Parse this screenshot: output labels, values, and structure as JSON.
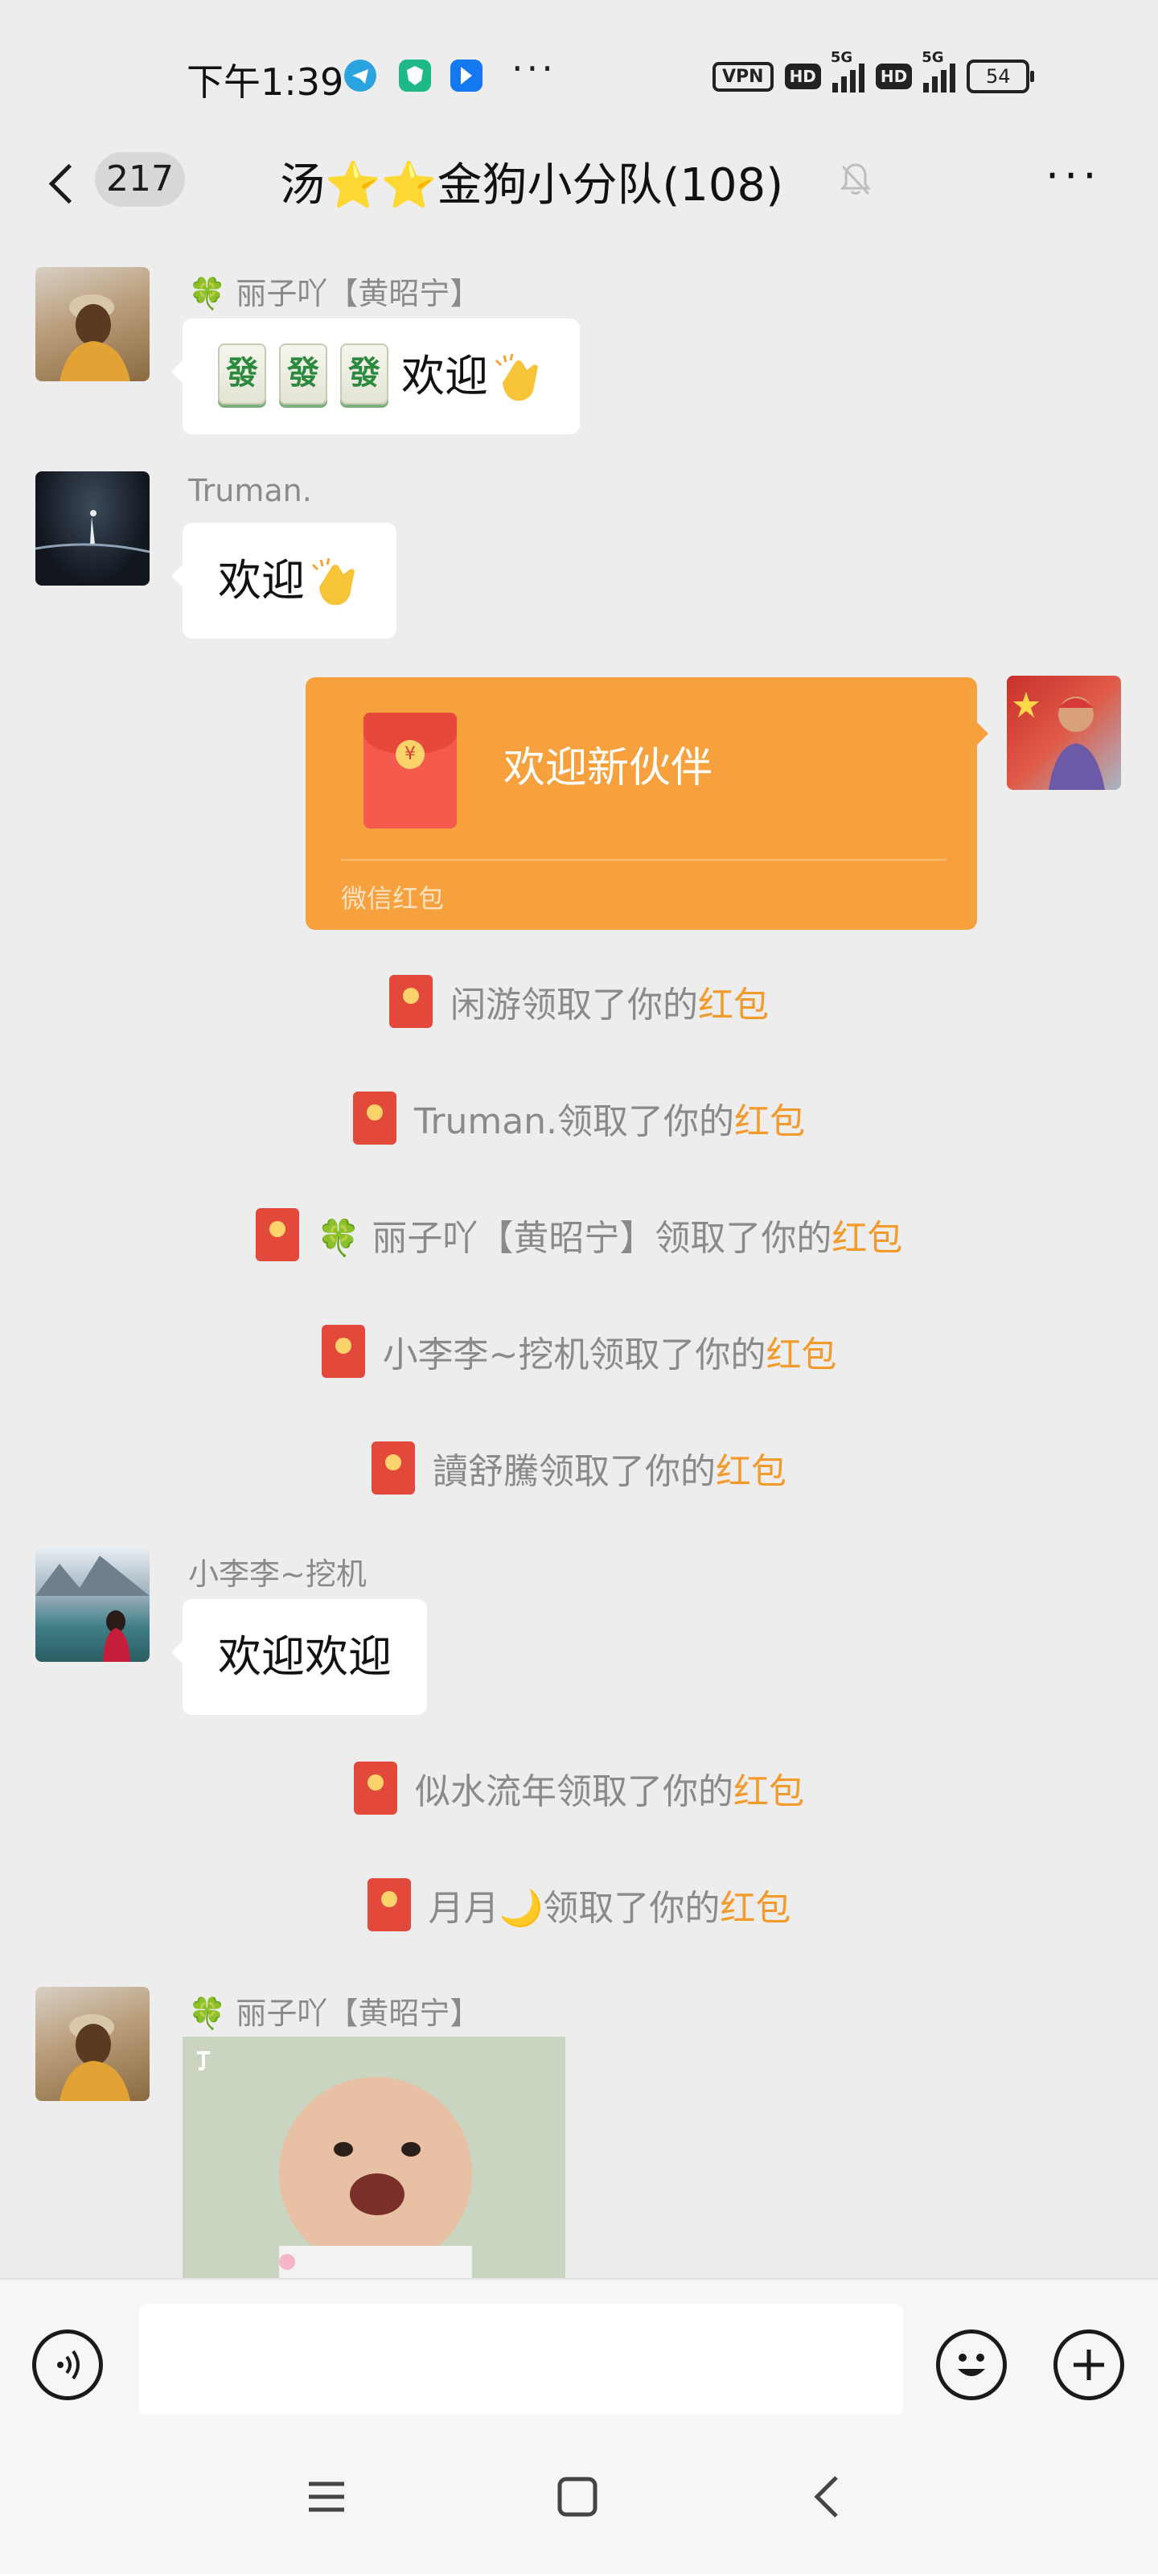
{
  "status_bar": {
    "time": "下午1:39",
    "vpn": "VPN",
    "hd1": "HD",
    "net1": "5G",
    "hd2": "HD",
    "net2": "5G",
    "battery": "54"
  },
  "header": {
    "unread_count": "217",
    "title": "汤⭐⭐金狗小分队(108)"
  },
  "messages": [
    {
      "sender": "🍀 丽子吖【黄昭宁】",
      "text": "欢迎"
    },
    {
      "sender": "Truman.",
      "text": "欢迎"
    },
    {
      "packet_title": "欢迎新伙伴",
      "packet_label": "微信红包"
    },
    {
      "sender": "小李李~挖机",
      "text": "欢迎欢迎"
    },
    {
      "sender": "🍀 丽子吖【黄昭宁】"
    }
  ],
  "notices": [
    {
      "who": "闲游领取了你的",
      "link": "红包"
    },
    {
      "who": "Truman.领取了你的",
      "link": "红包"
    },
    {
      "who": "🍀 丽子吖【黄昭宁】领取了你的",
      "link": "红包"
    },
    {
      "who": "小李李~挖机领取了你的",
      "link": "红包"
    },
    {
      "who": "讀舒騰领取了你的",
      "link": "红包"
    },
    {
      "who": "似水流年领取了你的",
      "link": "红包"
    },
    {
      "who": "月月🌙领取了你的",
      "link": "红包"
    }
  ],
  "mahjong_glyph": "發",
  "colors": {
    "background": "#ededed",
    "red_packet": "#f6a13d",
    "highlight": "#f39a2c",
    "bubble": "#ffffff"
  },
  "icons": [
    "back-icon",
    "mute-bell-icon",
    "more-icon",
    "voice-icon",
    "emoji-icon",
    "plus-icon",
    "menu-nav-icon",
    "home-nav-icon",
    "back-nav-icon"
  ]
}
